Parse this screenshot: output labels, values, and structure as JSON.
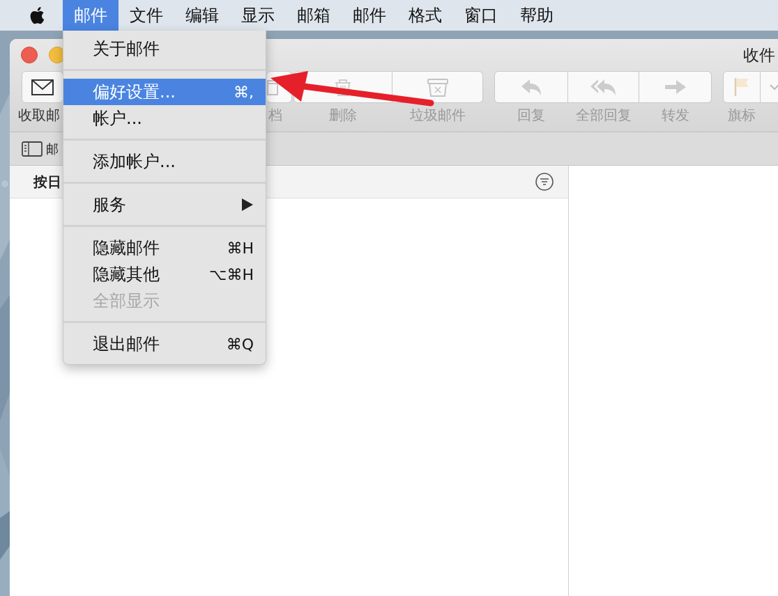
{
  "menu_bar": {
    "items": [
      {
        "label": "邮件",
        "selected": true
      },
      {
        "label": "文件",
        "selected": false
      },
      {
        "label": "编辑",
        "selected": false
      },
      {
        "label": "显示",
        "selected": false
      },
      {
        "label": "邮箱",
        "selected": false
      },
      {
        "label": "邮件",
        "selected": false
      },
      {
        "label": "格式",
        "selected": false
      },
      {
        "label": "窗口",
        "selected": false
      },
      {
        "label": "帮助",
        "selected": false
      }
    ]
  },
  "window": {
    "title": "收件",
    "toolbar": {
      "groups": [
        {
          "segments": [
            {
              "kind": "getmail",
              "label": "收取邮",
              "disabled": false
            }
          ]
        },
        {
          "segments": [
            {
              "kind": "archive",
              "label": "档",
              "disabled": true
            }
          ]
        },
        {
          "segments": [
            {
              "kind": "delete",
              "label": "删除",
              "disabled": true
            },
            {
              "kind": "junk",
              "label": "垃圾邮件",
              "disabled": true
            }
          ]
        },
        {
          "segments": [
            {
              "kind": "reply",
              "label": "回复",
              "disabled": true
            },
            {
              "kind": "replyall",
              "label": "全部回复",
              "disabled": true
            },
            {
              "kind": "forward",
              "label": "转发",
              "disabled": true
            }
          ]
        },
        {
          "segments": [
            {
              "kind": "flag",
              "label": "旗标",
              "disabled": true
            },
            {
              "kind": "flagmenu",
              "disabled": true
            }
          ]
        }
      ]
    },
    "favorites_bar": {
      "mailbox_button": "邮"
    },
    "message_list": {
      "sort_label": "按日"
    }
  },
  "menu": {
    "items": [
      {
        "kind": "item",
        "label": "关于邮件",
        "selected": false,
        "disabled": false
      },
      {
        "kind": "separator"
      },
      {
        "kind": "item",
        "label": "偏好设置...",
        "shortcut": "⌘,",
        "selected": true,
        "disabled": false
      },
      {
        "kind": "item",
        "label": "帐户...",
        "selected": false,
        "disabled": false
      },
      {
        "kind": "separator"
      },
      {
        "kind": "item",
        "label": "添加帐户...",
        "selected": false,
        "disabled": false
      },
      {
        "kind": "separator"
      },
      {
        "kind": "submenu",
        "label": "服务",
        "selected": false,
        "disabled": false
      },
      {
        "kind": "separator"
      },
      {
        "kind": "item",
        "label": "隐藏邮件",
        "shortcut": "⌘H",
        "selected": false,
        "disabled": false
      },
      {
        "kind": "item",
        "label": "隐藏其他",
        "shortcut": "⌥⌘H",
        "selected": false,
        "disabled": false
      },
      {
        "kind": "item",
        "label": "全部显示",
        "selected": false,
        "disabled": true
      },
      {
        "kind": "separator"
      },
      {
        "kind": "item",
        "label": "退出邮件",
        "shortcut": "⌘Q",
        "selected": false,
        "disabled": false
      }
    ]
  }
}
